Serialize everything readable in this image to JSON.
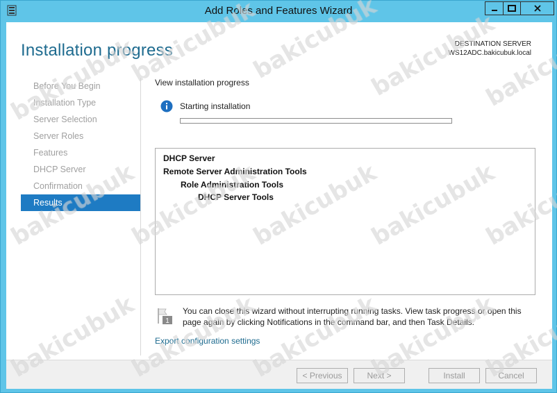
{
  "window": {
    "title": "Add Roles and Features Wizard",
    "controls": {
      "minimize": "minimize",
      "maximize": "maximize",
      "close": "close"
    }
  },
  "header": {
    "page_title": "Installation progress",
    "destination_label": "DESTINATION SERVER",
    "destination_server": "WS12ADC.bakicubuk.local"
  },
  "nav": {
    "items": [
      {
        "label": "Before You Begin",
        "active": false
      },
      {
        "label": "Installation Type",
        "active": false
      },
      {
        "label": "Server Selection",
        "active": false
      },
      {
        "label": "Server Roles",
        "active": false
      },
      {
        "label": "Features",
        "active": false
      },
      {
        "label": "DHCP Server",
        "active": false
      },
      {
        "label": "Confirmation",
        "active": false
      },
      {
        "label": "Results",
        "active": true
      }
    ]
  },
  "main": {
    "sub_heading": "View installation progress",
    "status": "Starting installation",
    "progress_fraction": 0.0,
    "results": [
      {
        "label": "DHCP Server",
        "level": 0
      },
      {
        "label": "Remote Server Administration Tools",
        "level": 0
      },
      {
        "label": "Role Administration Tools",
        "level": 1
      },
      {
        "label": "DHCP Server Tools",
        "level": 2
      }
    ],
    "notice_line1": "You can close this wizard without interrupting running tasks. View task progress or open this",
    "notice_line2": "page again by clicking Notifications in the command bar, and then Task Details.",
    "notice_badge": "1",
    "export_link": "Export configuration settings"
  },
  "footer": {
    "previous": "< Previous",
    "next": "Next >",
    "install": "Install",
    "cancel": "Cancel"
  },
  "watermark": "bakicubuk",
  "colors": {
    "titlebar": "#5fc5e8",
    "accent": "#1e7bc3",
    "title_text": "#1e6b8f"
  }
}
